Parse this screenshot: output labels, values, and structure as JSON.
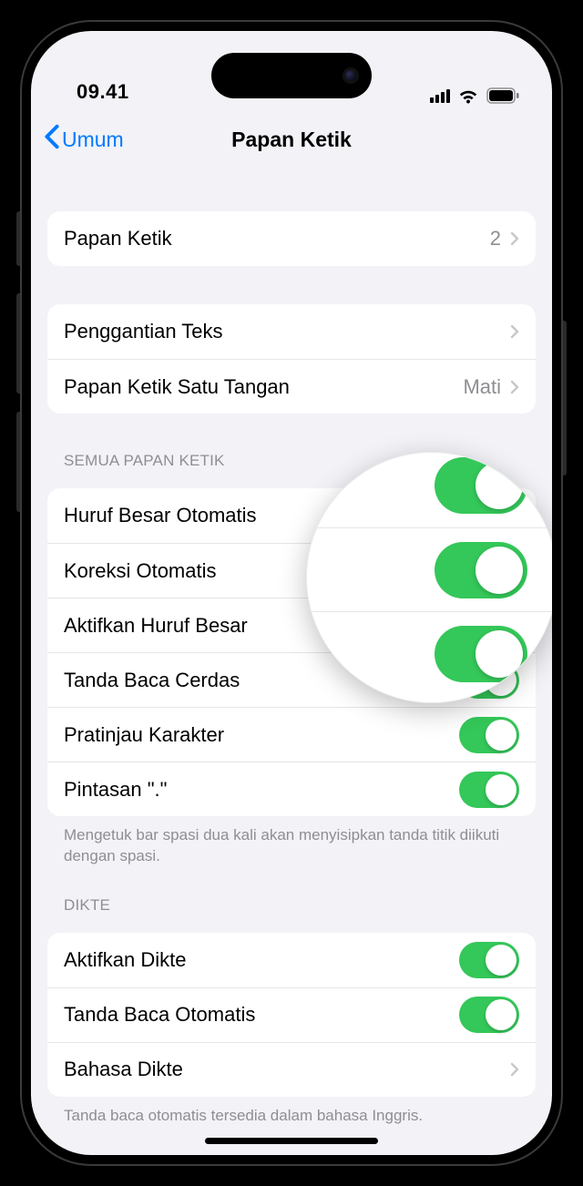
{
  "status": {
    "time": "09.41"
  },
  "nav": {
    "back_label": "Umum",
    "title": "Papan Ketik"
  },
  "group1": {
    "keyboard_label": "Papan Ketik",
    "keyboard_count": "2"
  },
  "group2": {
    "text_replacement_label": "Penggantian Teks",
    "one_handed_label": "Papan Ketik Satu Tangan",
    "one_handed_value": "Mati"
  },
  "all_keyboards": {
    "header": "SEMUA PAPAN KETIK",
    "rows": [
      {
        "label": "Huruf Besar Otomatis",
        "on": true
      },
      {
        "label": "Koreksi Otomatis",
        "on": true
      },
      {
        "label": "Aktifkan Huruf Besar",
        "on": true
      },
      {
        "label": "Tanda Baca Cerdas",
        "on": true
      },
      {
        "label": "Pratinjau Karakter",
        "on": true
      },
      {
        "label": "Pintasan \".\"",
        "on": true
      }
    ],
    "footer": "Mengetuk bar spasi dua kali akan menyisipkan tanda titik diikuti dengan spasi."
  },
  "dictation": {
    "header": "DIKTE",
    "rows": [
      {
        "label": "Aktifkan Dikte",
        "on": true
      },
      {
        "label": "Tanda Baca Otomatis",
        "on": true
      }
    ],
    "language_label": "Bahasa Dikte",
    "footer": "Tanda baca otomatis tersedia dalam bahasa Inggris."
  },
  "colors": {
    "accent": "#007aff",
    "toggle_on": "#34c759"
  }
}
